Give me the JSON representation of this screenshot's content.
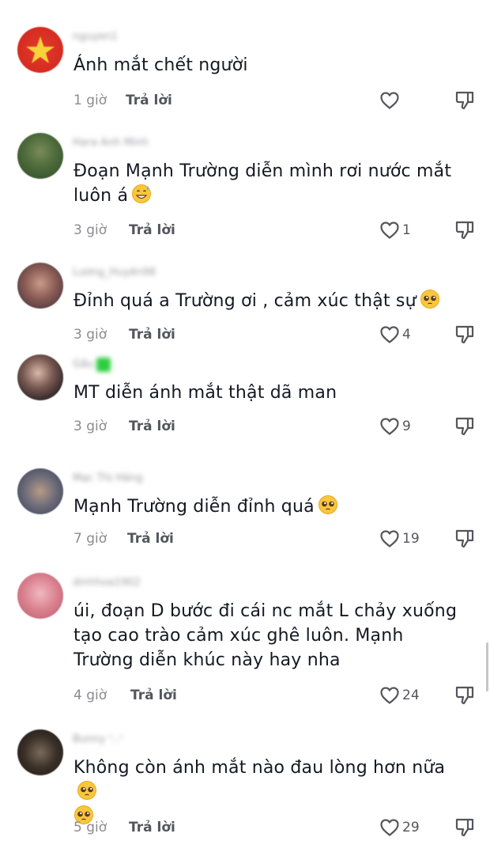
{
  "comments": [
    {
      "username": "nguyen1",
      "text": "Ánh mắt chết người",
      "time": "1 giờ",
      "reply": "Trả lời",
      "likes": ""
    },
    {
      "username": "Hara Anh Minh",
      "text": "Đoạn Mạnh Trường diễn mình rơi nước mắt luôn á",
      "time": "3 giờ",
      "reply": "Trả lời",
      "likes": "1"
    },
    {
      "username": "Lương_Huyền98",
      "text": "Đỉnh quá a Trường ơi , cảm xúc thật sự",
      "time": "3 giờ",
      "reply": "Trả lời",
      "likes": "4"
    },
    {
      "username": "Gấu",
      "text": "MT diễn ánh mắt thật dã man",
      "time": "3 giờ",
      "reply": "Trả lời",
      "likes": "9"
    },
    {
      "username": "Mạc Thị Hằng",
      "text": "Mạnh Trường diễn đỉnh quá",
      "time": "7 giờ",
      "reply": "Trả lời",
      "likes": "19"
    },
    {
      "username": "dinhhoa1902",
      "text": "úi, đoạn D bước đi cái nc mắt L chảy xuống tạo cao trào cảm xúc ghê luôn. Mạnh Trường diễn khúc này hay nha",
      "time": "4 giờ",
      "reply": "Trả lời",
      "likes": "24"
    },
    {
      "username": "Bunny",
      "text": "Không còn ánh mắt nào đau lòng hơn nữa",
      "time": "5 giờ",
      "reply": "Trả lời",
      "likes": "29"
    }
  ],
  "icons": {
    "like": "heart-outline-icon",
    "dislike": "thumbs-down-outline-icon",
    "emoji_sweat": "grinning-sweat-emoji",
    "emoji_pleading": "pleading-face-emoji"
  }
}
